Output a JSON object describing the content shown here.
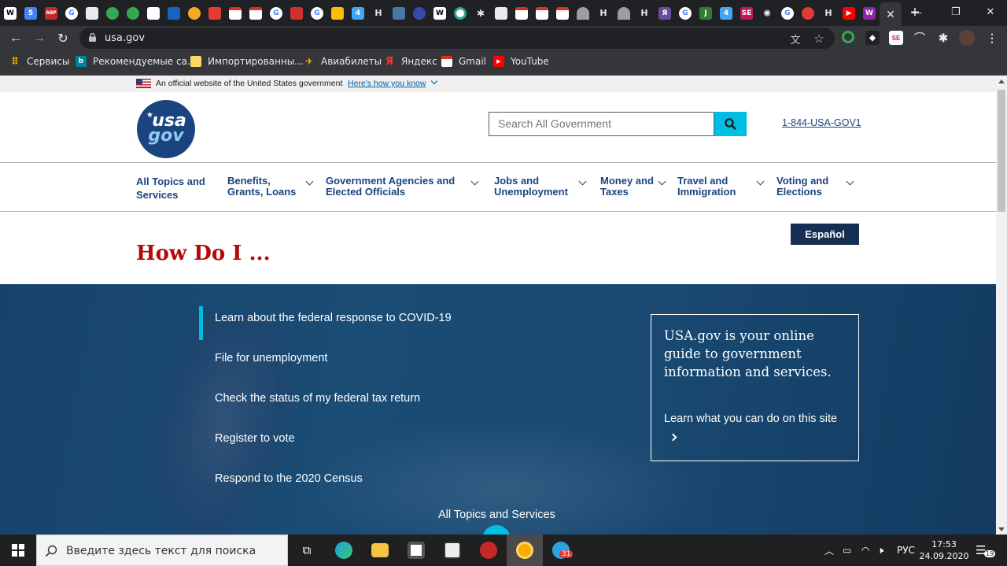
{
  "browser": {
    "url": "usa.gov",
    "tab_favicons": [
      "W",
      "5",
      "ABP",
      "G",
      "",
      "",
      "",
      "",
      "",
      "",
      "",
      "",
      "",
      "",
      "",
      "",
      "",
      "",
      "",
      "G",
      "",
      "",
      "",
      "H",
      "",
      "",
      "W",
      "",
      "",
      "",
      "",
      "",
      "",
      "",
      "H",
      "",
      "H",
      "Я",
      "G",
      "J",
      "",
      "",
      "",
      "G",
      "",
      "H",
      "",
      "W"
    ],
    "bookmarks": [
      {
        "label": "Сервисы",
        "icon": "apps-grid-icon"
      },
      {
        "label": "Рекомендуемые са...",
        "icon": "bing-icon"
      },
      {
        "label": "Импортированны...",
        "icon": "folder-icon"
      },
      {
        "label": "Авиабилеты",
        "icon": "plane-icon"
      },
      {
        "label": "Яндекс",
        "icon": "yandex-icon"
      },
      {
        "label": "Gmail",
        "icon": "gmail-icon"
      },
      {
        "label": "YouTube",
        "icon": "youtube-icon"
      }
    ]
  },
  "page": {
    "gov_banner": {
      "text": "An official website of the United States government",
      "link": "Here's how you know"
    },
    "logo": {
      "line1": "usa",
      "line2": "gov"
    },
    "search": {
      "placeholder": "Search All Government"
    },
    "phone": "1-844-USA-GOV1",
    "nav": [
      {
        "line1": "All Topics and",
        "line2": "Services",
        "has_chevron": false
      },
      {
        "line1": "Benefits,",
        "line2": "Grants, Loans",
        "has_chevron": true
      },
      {
        "line1": "Government Agencies and",
        "line2": "Elected Officials",
        "has_chevron": true
      },
      {
        "line1": "Jobs and",
        "line2": "Unemployment",
        "has_chevron": true
      },
      {
        "line1": "Money and",
        "line2": "Taxes",
        "has_chevron": true
      },
      {
        "line1": "Travel and",
        "line2": "Immigration",
        "has_chevron": true
      },
      {
        "line1": "Voting and",
        "line2": "Elections",
        "has_chevron": true
      }
    ],
    "espanol": "Español",
    "how_do_i": "How Do I ...",
    "how_links": [
      "Learn about the federal response to COVID-19",
      "File for unemployment",
      "Check the status of my federal tax return",
      "Register to vote",
      "Respond to the 2020 Census"
    ],
    "guide": {
      "title": "USA.gov is your online guide to government information and services.",
      "link": "Learn what you can do on this site"
    },
    "all_topics_link": "All Topics and Services"
  },
  "taskbar": {
    "search_placeholder": "Введите здесь текст для поиска",
    "language": "РУС",
    "time": "17:53",
    "date": "24.09.2020",
    "telegram_badge": "31",
    "notification_count": "19"
  },
  "colors": {
    "brand_navy": "#1a4480",
    "dark_navy": "#162e51",
    "cyan": "#00bde3",
    "heading_red": "#b50909"
  }
}
